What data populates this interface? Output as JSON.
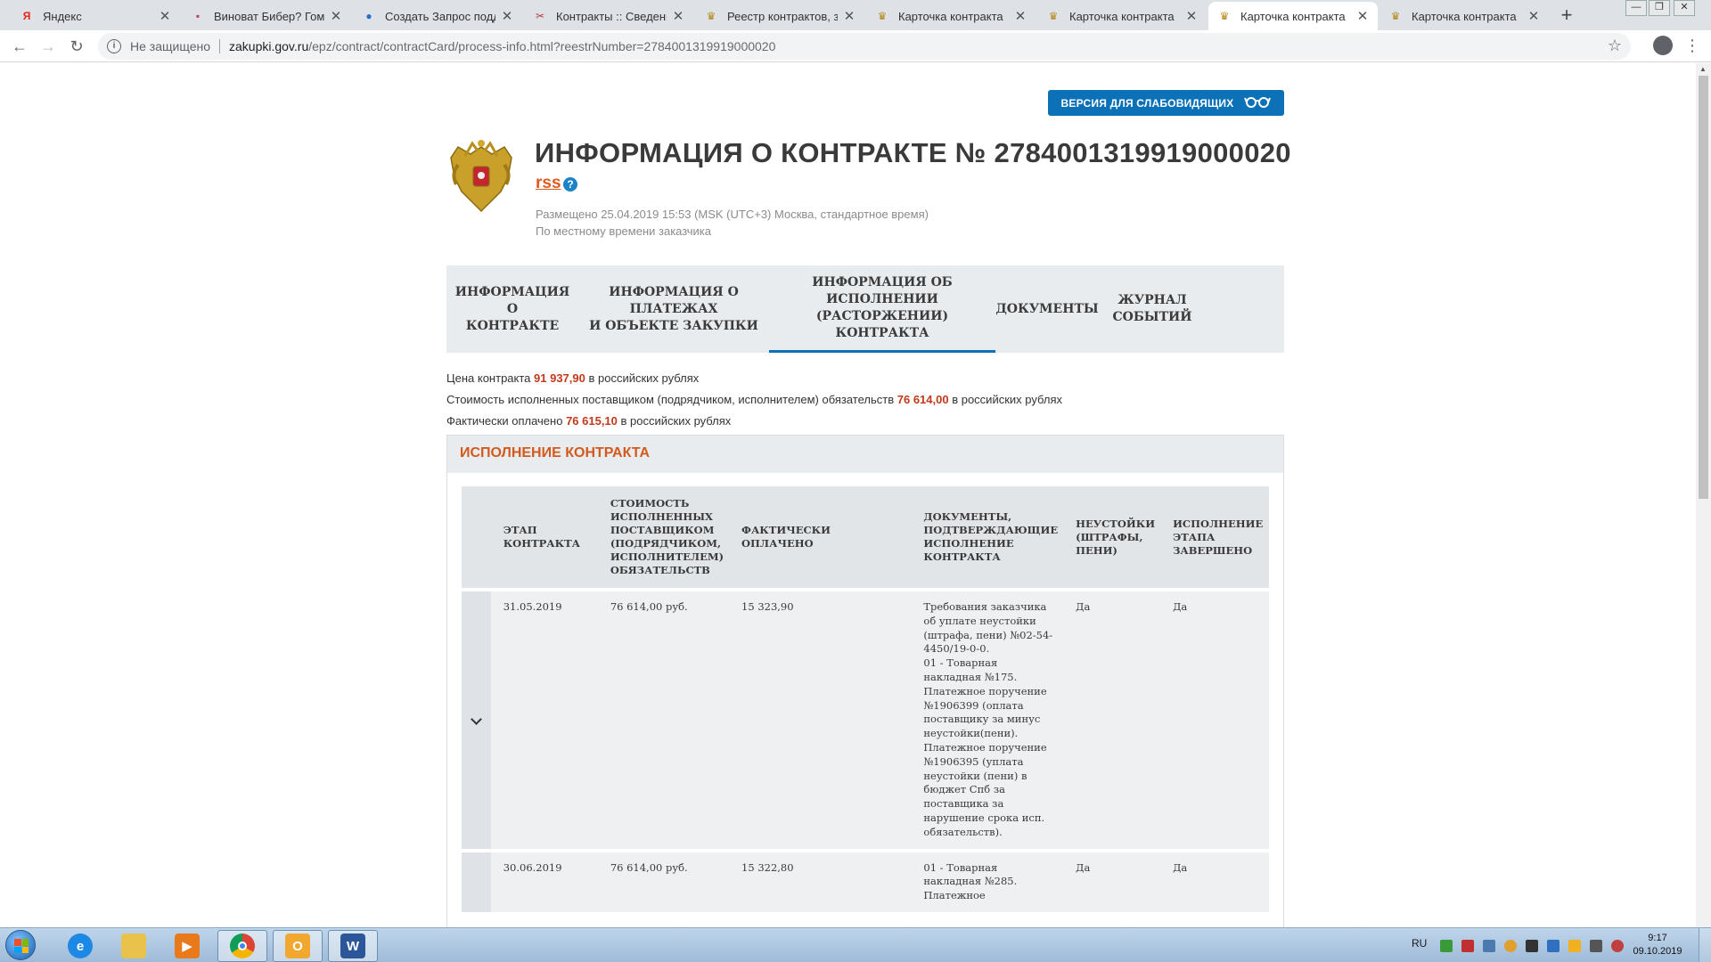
{
  "browser": {
    "tabs": [
      {
        "label": "Яндекс",
        "favicon": "Я",
        "favicon_color": "#e62617"
      },
      {
        "label": "Виноват Бибер? Гомес",
        "favicon": "▪",
        "favicon_color": "#c23a6b"
      },
      {
        "label": "Создать Запрос подде",
        "favicon": "●",
        "favicon_color": "#2a6fc9"
      },
      {
        "label": "Контракты :: Сведения",
        "favicon": "✂",
        "favicon_color": "#b33a3a"
      },
      {
        "label": "Реестр контрактов, зак",
        "favicon": "♛",
        "favicon_color": "#b58a1a"
      },
      {
        "label": "Карточка контракта",
        "favicon": "♛",
        "favicon_color": "#b58a1a"
      },
      {
        "label": "Карточка контракта",
        "favicon": "♛",
        "favicon_color": "#b58a1a"
      },
      {
        "label": "Карточка контракта",
        "favicon": "♛",
        "favicon_color": "#b58a1a"
      },
      {
        "label": "Карточка контракта",
        "favicon": "♛",
        "favicon_color": "#b58a1a"
      }
    ],
    "active_tab_index": 7,
    "address": {
      "security": "Не защищено",
      "host": "zakupki.gov.ru",
      "path": "/epz/contract/contractCard/process-info.html?reestrNumber=2784001319919000020"
    }
  },
  "page": {
    "accessibility_button": "ВЕРСИЯ ДЛЯ СЛАБОВИДЯЩИХ",
    "title": "ИНФОРМАЦИЯ О КОНТРАКТЕ № 2784001319919000020",
    "rss": "rss",
    "posted_line1": "Размещено 25.04.2019 15:53 (MSK (UTC+3) Москва, стандартное время)",
    "posted_line2": "По местному времени заказчика",
    "tabs": [
      {
        "label_1": "ИНФОРМАЦИЯ О",
        "label_2": "КОНТРАКТЕ"
      },
      {
        "label_1": "ИНФОРМАЦИЯ О ПЛАТЕЖАХ",
        "label_2": "И ОБЪЕКТЕ ЗАКУПКИ"
      },
      {
        "label_1": "ИНФОРМАЦИЯ ОБ ИСПОЛНЕНИИ",
        "label_2": "(РАСТОРЖЕНИИ) КОНТРАКТА"
      },
      {
        "label_1": "ДОКУМЕНТЫ",
        "label_2": ""
      },
      {
        "label_1": "ЖУРНАЛ",
        "label_2": "СОБЫТИЙ"
      }
    ],
    "active_tab_index": 2,
    "summary": {
      "price_pre": "Цена контракта ",
      "price_value": "91 937,90",
      "price_post": " в российских рублях",
      "executed_pre": "Стоимость исполненных поставщиком (подрядчиком, исполнителем) обязательств ",
      "executed_value": "76 614,00",
      "executed_post": " в российских рублях",
      "paid_pre": "Фактически оплачено ",
      "paid_value": "76 615,10",
      "paid_post": " в российских рублях"
    },
    "section_title": "ИСПОЛНЕНИЕ КОНТРАКТА",
    "table": {
      "headers": [
        "ЭТАП КОНТРАКТА",
        "СТОИМОСТЬ ИСПОЛНЕННЫХ ПОСТАВЩИКОМ (ПОДРЯДЧИКОМ, ИСПОЛНИТЕЛЕМ) ОБЯЗАТЕЛЬСТВ",
        "ФАКТИЧЕСКИ ОПЛАЧЕНО",
        "ДОКУМЕНТЫ, ПОДТВЕРЖДАЮЩИЕ ИСПОЛНЕНИЕ КОНТРАКТА",
        "НЕУСТОЙКИ (ШТРАФЫ, ПЕНИ)",
        "ИСПОЛНЕНИЕ ЭТАПА ЗАВЕРШЕНО"
      ],
      "rows": [
        {
          "stage": "31.05.2019",
          "cost": "76 614,00 руб.",
          "paid": "15 323,90",
          "docs": "Требования заказчика об уплате неустойки (штрафа, пени) №02-54-4450/19-0-0.\n01 - Товарная накладная №175.\nПлатежное поручение №1906399 (оплата поставщику за минус неустойки(пени).\nПлатежное поручение №1906395 (уплата неустойки (пени) в бюджет Спб за поставщика за нарушение срока исп. обязательств).",
          "penalties": "Да",
          "completed": "Да"
        },
        {
          "stage": "30.06.2019",
          "cost": "76 614,00 руб.",
          "paid": "15 322,80",
          "docs": "01 - Товарная накладная №285.\nПлатежное",
          "penalties": "Да",
          "completed": "Да"
        }
      ]
    }
  },
  "taskbar": {
    "lang": "RU",
    "time": "9:17",
    "date": "09.10.2019"
  }
}
